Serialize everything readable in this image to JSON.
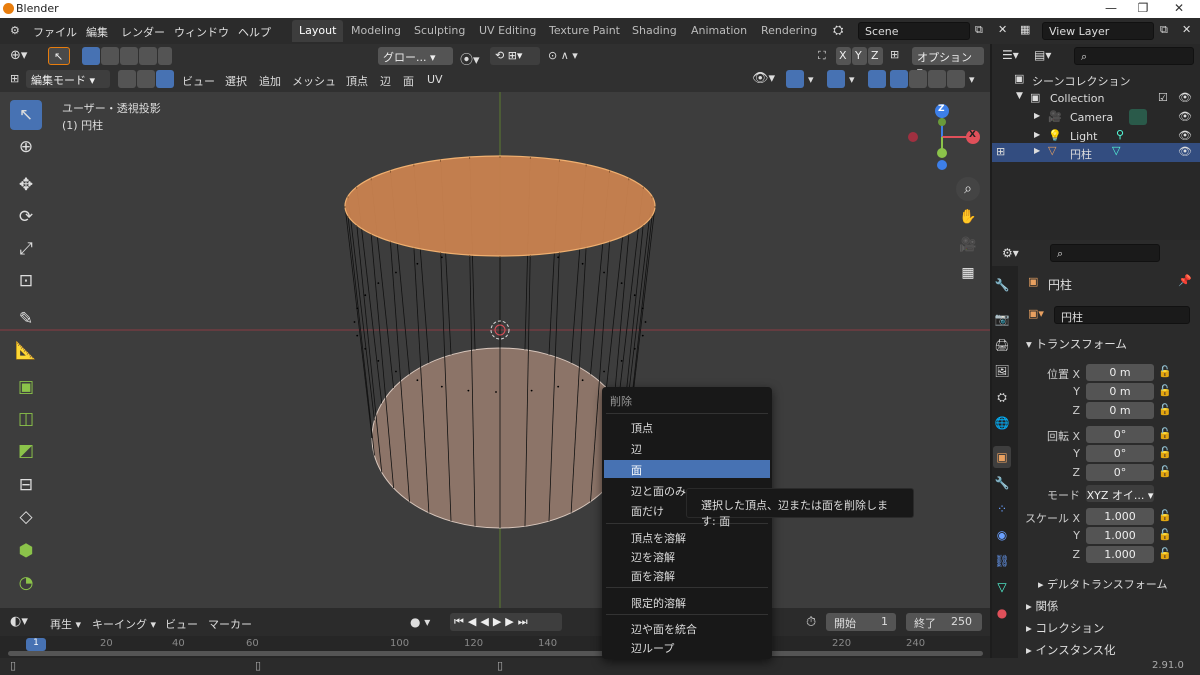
{
  "window": {
    "title": "Blender"
  },
  "menubar": {
    "items": [
      "ファイル",
      "編集",
      "レンダー",
      "ウィンドウ",
      "ヘルプ"
    ],
    "workspaces": [
      "Layout",
      "Modeling",
      "Sculpting",
      "UV Editing",
      "Texture Paint",
      "Shading",
      "Animation",
      "Rendering"
    ],
    "scene": "Scene",
    "view_layer": "View Layer"
  },
  "viewport_header": {
    "transform_orientation": "グロー...",
    "options_label": "オプション",
    "axis_labels": [
      "X",
      "Y",
      "Z"
    ],
    "mode": "編集モード",
    "menus": [
      "ビュー",
      "選択",
      "追加",
      "メッシュ",
      "頂点",
      "辺",
      "面",
      "UV"
    ]
  },
  "viewport": {
    "view_name": "ユーザー・透視投影",
    "object_label": "(1) 円柱",
    "gizmo_axes": [
      "Z",
      "X"
    ]
  },
  "context_menu": {
    "title": "削除",
    "items": [
      "頂点",
      "辺",
      "面",
      "辺と面のみ",
      "面だけ",
      "頂点を溶解",
      "辺を溶解",
      "面を溶解",
      "限定的溶解",
      "辺や面を統合",
      "辺ループ"
    ],
    "highlighted": "面"
  },
  "tooltip": {
    "text": "選択した頂点、辺または面を削除します:  面"
  },
  "timeline": {
    "menus": [
      "再生",
      "キーイング",
      "ビュー",
      "マーカー"
    ],
    "start_label": "開始",
    "start_value": "1",
    "end_label": "終了",
    "end_value": "250",
    "current_frame": "1",
    "ruler_ticks": [
      "20",
      "40",
      "60",
      "100",
      "120",
      "140",
      "220",
      "240"
    ]
  },
  "outliner": {
    "root": "シーンコレクション",
    "items": [
      {
        "label": "Collection"
      },
      {
        "label": "Camera"
      },
      {
        "label": "Light"
      },
      {
        "label": "円柱"
      }
    ]
  },
  "properties": {
    "object_name": "円柱",
    "datablock_name": "円柱",
    "transform_header": "トランスフォーム",
    "location_label": "位置",
    "rotation_label": "回転",
    "scale_label": "スケール",
    "mode_label": "モード",
    "mode_value": "XYZ オイ...",
    "axes": [
      "X",
      "Y",
      "Z"
    ],
    "location": [
      "0 m",
      "0 m",
      "0 m"
    ],
    "rotation": [
      "0°",
      "0°",
      "0°"
    ],
    "scale": [
      "1.000",
      "1.000",
      "1.000"
    ],
    "sections": [
      "デルタトランスフォーム",
      "関係",
      "コレクション",
      "インスタンス化"
    ]
  },
  "statusbar": {
    "version": "2.91.0"
  },
  "colors": {
    "accent": "#4772b3",
    "selection_orange": "#e8a060",
    "x_axis": "#e0505a",
    "z_axis": "#3d7fe8"
  }
}
